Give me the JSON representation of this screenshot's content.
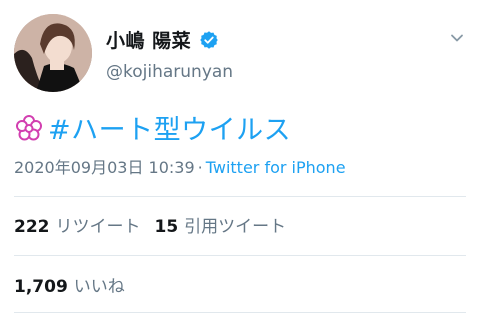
{
  "user": {
    "display_name": "小嶋 陽菜",
    "handle": "@kojiharunyan",
    "verified_icon": "verified-badge-icon",
    "avatar_icon": "profile-photo"
  },
  "tweet": {
    "emoji_icon": "white-flower-icon",
    "hashtag": "#ハート型ウイルス",
    "timestamp": "2020年09月03日 10:39",
    "separator": "·",
    "source": "Twitter for iPhone"
  },
  "stats": {
    "retweets_count": "222",
    "retweets_label": "リツイート",
    "quotes_count": "15",
    "quotes_label": "引用ツイート",
    "likes_count": "1,709",
    "likes_label": "いいね"
  },
  "colors": {
    "link": "#1da1f2",
    "muted": "#657786",
    "text": "#14171a",
    "flower": "#d23fb0"
  }
}
